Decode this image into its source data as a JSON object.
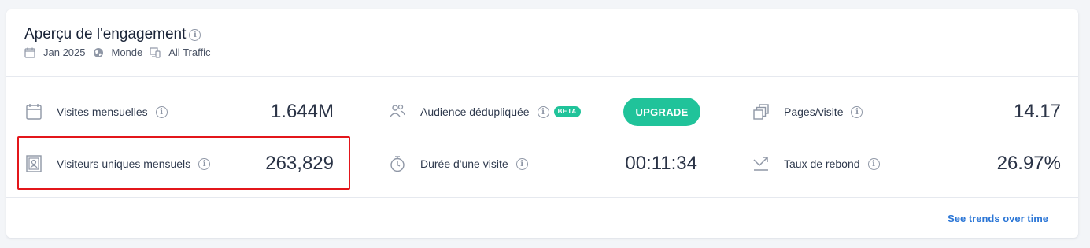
{
  "header": {
    "title": "Aperçu de l'engagement",
    "date": "Jan 2025",
    "region": "Monde",
    "traffic": "All Traffic"
  },
  "metrics": {
    "visits": {
      "label": "Visites mensuelles",
      "value": "1.644M"
    },
    "unique": {
      "label": "Visiteurs uniques mensuels",
      "value": "263,829"
    },
    "dedup": {
      "label": "Audience dédupliquée",
      "badge": "BETA",
      "button": "UPGRADE"
    },
    "duration": {
      "label": "Durée d'une visite",
      "value": "00:11:34"
    },
    "pages": {
      "label": "Pages/visite",
      "value": "14.17"
    },
    "bounce": {
      "label": "Taux de rebond",
      "value": "26.97%"
    }
  },
  "footer": {
    "trends_link": "See trends over time"
  },
  "colors": {
    "accent": "#20c39a",
    "link": "#2b76d6",
    "highlight": "#e3161b"
  }
}
